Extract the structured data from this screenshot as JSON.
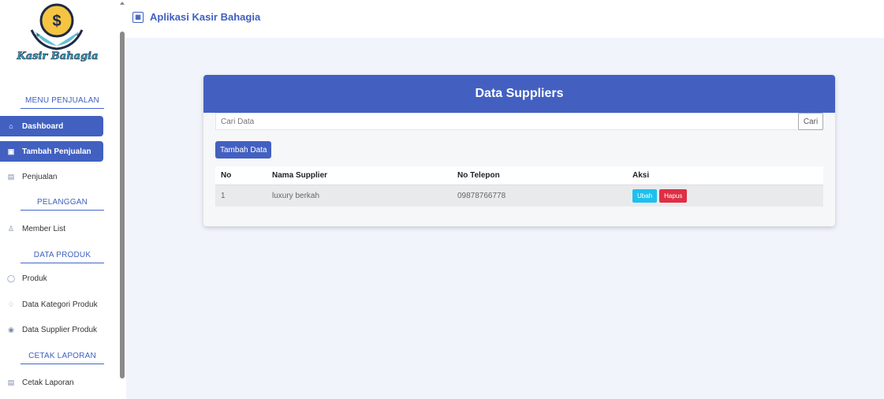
{
  "app": {
    "title": "Aplikasi Kasir Bahagia"
  },
  "logo": {
    "text": "Kasir Bahagia",
    "symbol": "$"
  },
  "sidebar": {
    "sections": [
      "MENU PENJUALAN",
      "PELANGGAN",
      "DATA PRODUK",
      "CETAK LAPORAN"
    ],
    "items": [
      {
        "label": "Dashboard",
        "icon": "home-icon",
        "active": true
      },
      {
        "label": "Tambah Penjualan",
        "icon": "cart-icon",
        "active": true
      },
      {
        "label": "Penjualan",
        "icon": "list-icon",
        "active": false
      },
      {
        "label": "Member List",
        "icon": "users-icon",
        "active": false
      },
      {
        "label": "Produk",
        "icon": "box-icon",
        "active": false
      },
      {
        "label": "Data Kategori Produk",
        "icon": "tag-icon",
        "active": false
      },
      {
        "label": "Data Supplier Produk",
        "icon": "supplier-icon",
        "active": false
      },
      {
        "label": "Cetak Laporan",
        "icon": "print-icon",
        "active": false
      }
    ]
  },
  "main": {
    "card_title": "Data Suppliers",
    "search_placeholder": "Cari Data",
    "search_button": "Cari",
    "add_button": "Tambah Data",
    "table": {
      "headers": [
        "No",
        "Nama Supplier",
        "No Telepon",
        "Aksi"
      ],
      "rows": [
        {
          "no": "1",
          "name": "luxury berkah",
          "phone": "09878766778",
          "edit": "Ubah",
          "delete": "Hapus"
        }
      ]
    }
  },
  "colors": {
    "primary": "#4360c1",
    "info": "#1ec0ee",
    "danger": "#df2f45",
    "background": "#f1f4fb"
  }
}
